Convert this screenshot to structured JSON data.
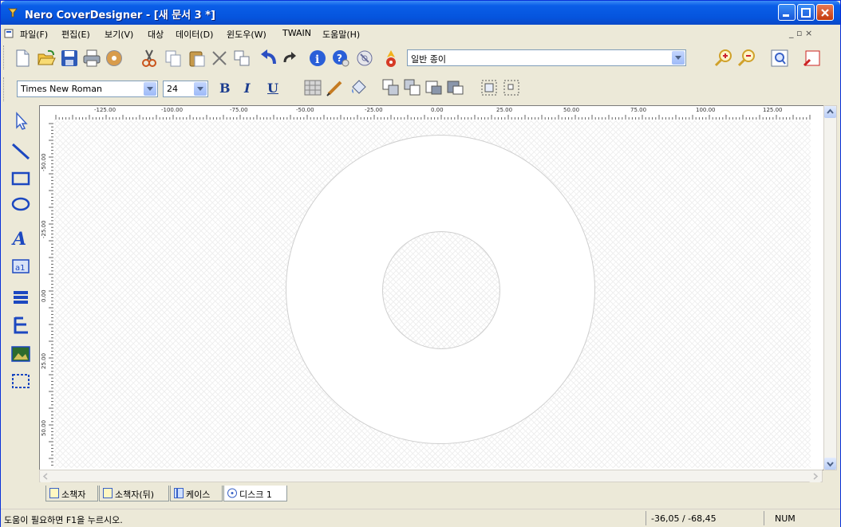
{
  "window": {
    "title": "Nero CoverDesigner - [새 문서 3 *]",
    "minimize_icon": "minimize-icon",
    "maximize_icon": "maximize-icon",
    "close_icon": "close-icon"
  },
  "menu": {
    "items": [
      "파일(F)",
      "편집(E)",
      "보기(V)",
      "대상",
      "데이터(D)",
      "윈도우(W)",
      "TWAIN",
      "도움말(H)"
    ],
    "mdi_controls": "_ ▫ ×"
  },
  "toolbar": {
    "paper_select": "일반 종이",
    "icons": [
      "new-icon",
      "open-icon",
      "save-icon",
      "print-icon",
      "burn-icon",
      "cut-icon",
      "copy-icon",
      "paste-icon",
      "delete-icon",
      "duplicate-icon",
      "undo-icon",
      "redo-icon",
      "info-icon",
      "help-icon",
      "properties-icon",
      "disc-print-icon",
      "zoom-in-icon",
      "zoom-out-icon",
      "zoom-fit-icon",
      "zoom-page-icon"
    ]
  },
  "format": {
    "font_name": "Times New Roman",
    "font_size": "24",
    "bold": "B",
    "italic": "I",
    "underline": "U"
  },
  "ruler": {
    "h_labels": [
      "-125.00",
      "-100.00",
      "-75.00",
      "-50.00",
      "-25.00",
      "0.00",
      "25.00",
      "50.00",
      "75.00",
      "100.00",
      "125.00"
    ],
    "v_labels": [
      "-50.00",
      "-25.00",
      "0.00",
      "25.00",
      "50.00"
    ]
  },
  "tabs": [
    {
      "label": "소책자"
    },
    {
      "label": "소책자(뒤)"
    },
    {
      "label": "케이스"
    },
    {
      "label": "디스크 1"
    }
  ],
  "status": {
    "help_text": "도움이 필요하면 F1을 누르시오.",
    "coords": "-36,05 / -68,45",
    "num": "NUM"
  },
  "colors": {
    "titlebar": "#0554dd",
    "close_button": "#c33a0d",
    "chrome": "#ece9d8"
  }
}
